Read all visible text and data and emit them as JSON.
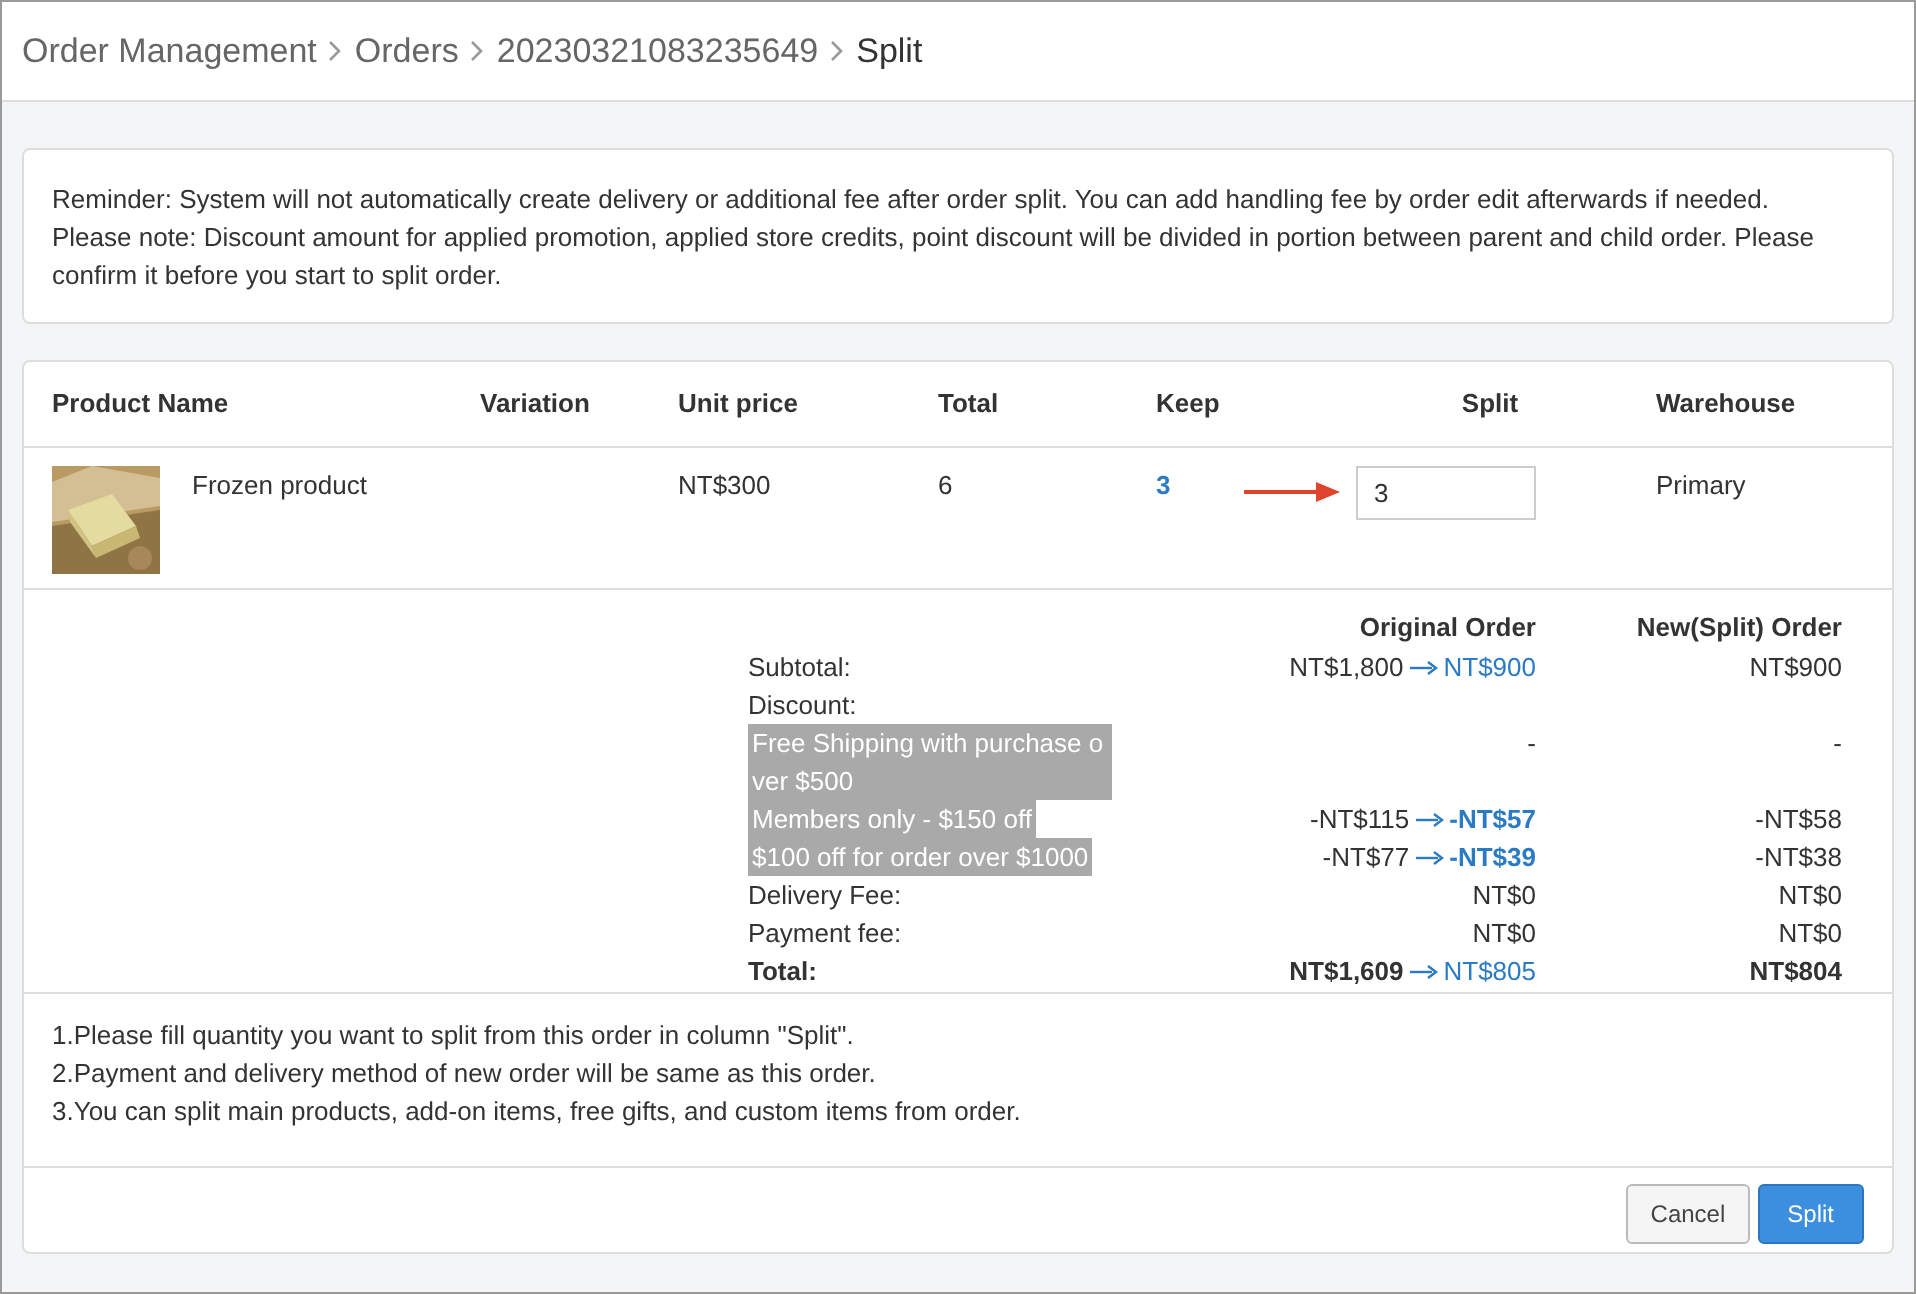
{
  "breadcrumb": [
    {
      "label": "Order Management",
      "current": false
    },
    {
      "label": "Orders",
      "current": false
    },
    {
      "label": "20230321083235649",
      "current": false
    },
    {
      "label": "Split",
      "current": true
    }
  ],
  "notice": [
    "Reminder: System will not automatically create delivery or additional fee after order split. You can add handling fee by order edit afterwards if needed.",
    "Please note: Discount amount for applied promotion, applied store credits, point discount will be divided in portion between parent and child order. Please confirm it before you start to split order."
  ],
  "table": {
    "columns": [
      "Product Name",
      "Variation",
      "Unit price",
      "Total",
      "Keep",
      "Split",
      "Warehouse"
    ],
    "rows": [
      {
        "product_name": "Frozen product",
        "unit_price": "NT$300",
        "total": "6",
        "keep": "3",
        "split": "3",
        "warehouse": "Primary"
      }
    ]
  },
  "summary": {
    "columns": [
      "Original Order",
      "New(Split) Order"
    ],
    "rows": [
      {
        "kind": "plain",
        "label": "Subtotal:",
        "original": "NT$1,800",
        "original_after": "NT$900",
        "split": "NT$900"
      },
      {
        "kind": "heading",
        "label": "Discount:"
      },
      {
        "kind": "discount",
        "label": "Free Shipping with purchase over $500",
        "original": "-",
        "split": "-"
      },
      {
        "kind": "discount",
        "label": "Members only - $150 off",
        "original": "-NT$115",
        "original_after": "-NT$57",
        "split": "-NT$58"
      },
      {
        "kind": "discount",
        "label": "$100 off for order over $1000",
        "original": "-NT$77",
        "original_after": "-NT$39",
        "split": "-NT$38"
      },
      {
        "kind": "plain",
        "label": "Delivery Fee:",
        "original": "NT$0",
        "split": "NT$0"
      },
      {
        "kind": "plain",
        "label": "Payment fee:",
        "original": "NT$0",
        "split": "NT$0"
      },
      {
        "kind": "total",
        "label": "Total:",
        "original": "NT$1,609",
        "original_after": "NT$805",
        "split": "NT$804"
      }
    ]
  },
  "notes": [
    "1.Please fill quantity you want to split from this order in column \"Split\".",
    "2.Payment and delivery method of new order will be same as this order.",
    "3.You can split main products, add-on items, free gifts, and custom items from order."
  ],
  "buttons": [
    {
      "label": "Cancel",
      "kind": "secondary"
    },
    {
      "label": "Split",
      "kind": "primary"
    }
  ]
}
